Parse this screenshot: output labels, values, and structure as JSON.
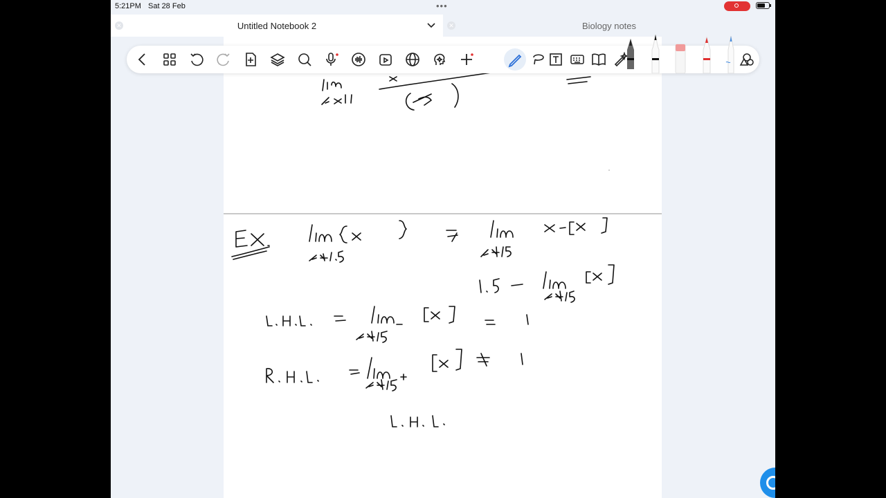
{
  "status_bar": {
    "time": "5:21PM",
    "date": "Sat 28 Feb",
    "recording_color": "#e23333"
  },
  "tabs": [
    {
      "title": "Untitled Notebook 2",
      "active": true
    },
    {
      "title": "Biology notes",
      "active": false
    }
  ],
  "toolbar": {
    "left_tools": [
      "chevron-left-icon",
      "grid-icon",
      "undo-icon",
      "redo-icon",
      "add-page-icon",
      "layers-icon",
      "search-icon",
      "microphone-icon",
      "audio-wave-icon",
      "media-icon",
      "globe-icon",
      "ai-head-icon",
      "add-icon"
    ],
    "right_tools": [
      "pen-icon",
      "lasso-icon",
      "text-box-icon",
      "keyboard-icon",
      "book-icon",
      "magic-pen-icon",
      "shape-icon"
    ],
    "pens": [
      {
        "name": "fountain-pen",
        "color": "#555555"
      },
      {
        "name": "ballpoint-pen",
        "color": "#111111"
      },
      {
        "name": "eraser",
        "color": "#f19a9a"
      },
      {
        "name": "red-pen",
        "color": "#e03030"
      },
      {
        "name": "blue-pen",
        "color": "#4a8fe0"
      }
    ]
  },
  "notes": {
    "top_fragment": [
      "lim",
      "x→1",
      "x",
      "(x−1)"
    ],
    "example": {
      "label": "Ex.",
      "problem": [
        "lim",
        "{x}",
        "x→1.5"
      ],
      "equiv": [
        "⇒",
        "lim",
        "x→1.5",
        "x − [x]"
      ],
      "step": [
        "1.5",
        "−",
        "lim",
        "[x]",
        "x→1.5"
      ],
      "lhl": {
        "label": "L.H.L.",
        "eq": "=",
        "lim": "lim",
        "sub": "x→1.5⁻",
        "arg": "[x]",
        "result_eq": "=",
        "result": "1"
      },
      "rhl": {
        "label": "R.H.L.",
        "eq": "=",
        "lim": "lim",
        "sub": "x→1.5⁺",
        "arg": "[x]",
        "result_eq": "=",
        "result": "1"
      },
      "conclusion": "L.H.L."
    }
  }
}
